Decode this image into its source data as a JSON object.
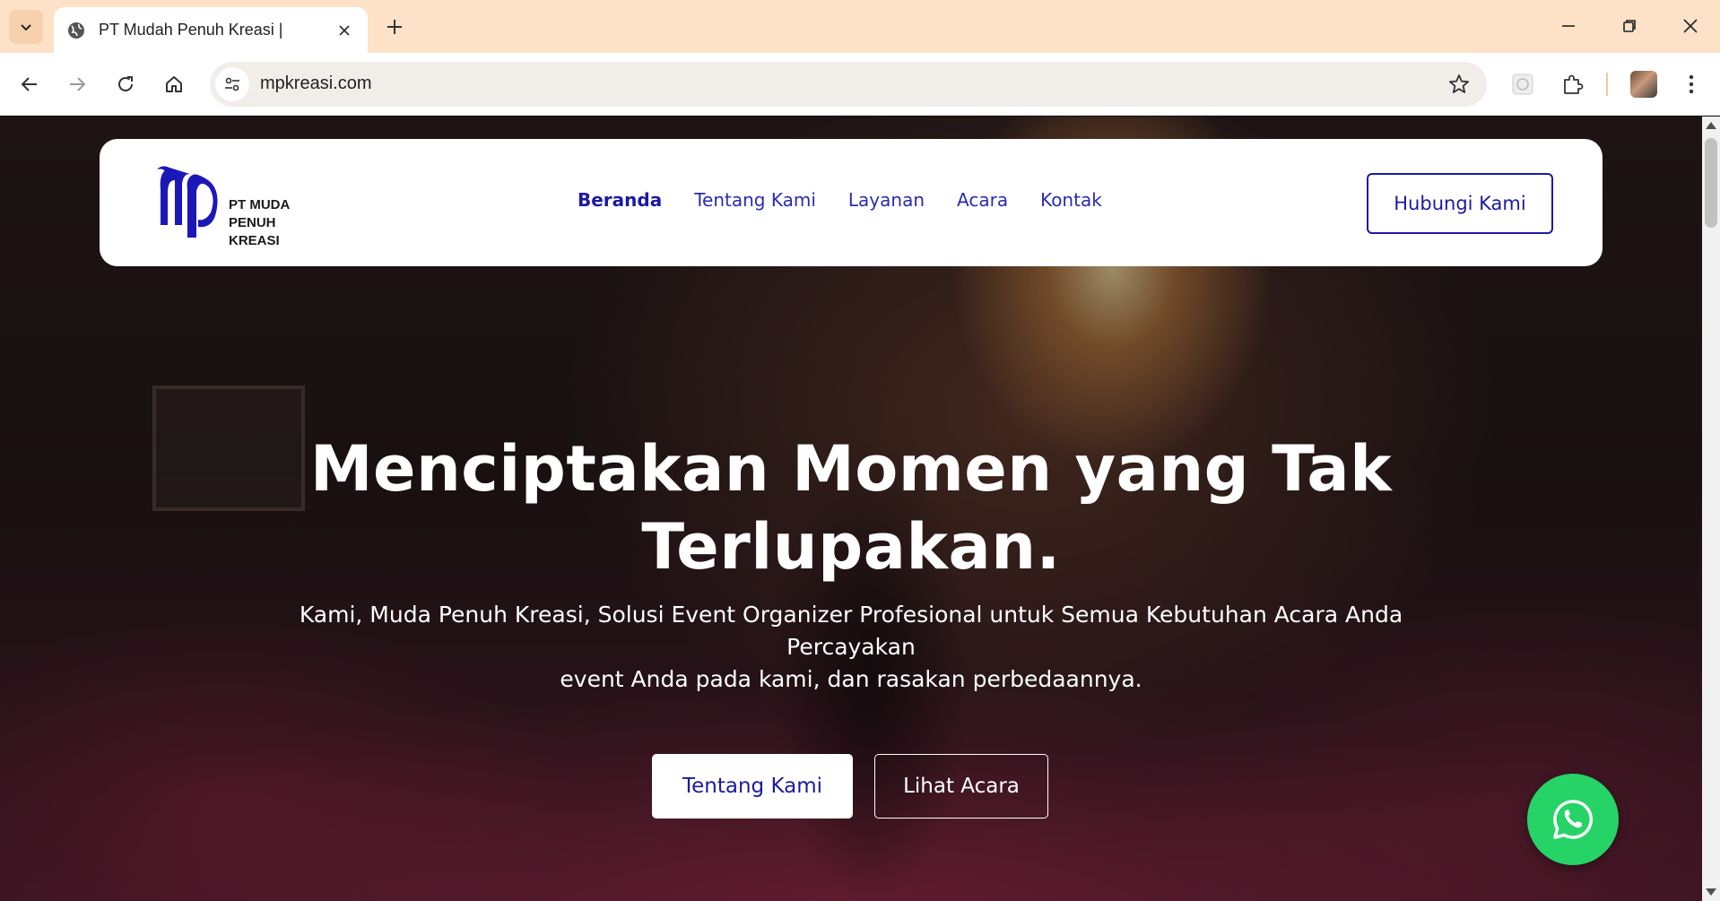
{
  "browser": {
    "tab_title": "PT Mudah Penuh Kreasi |",
    "url": "mpkreasi.com",
    "icons": {
      "tab_list": "chevron-down-icon",
      "tab_favicon": "globe-icon",
      "tab_close": "close-icon",
      "new_tab": "plus-icon",
      "minimize": "minimize-icon",
      "restore": "restore-icon",
      "close_window": "close-icon",
      "back": "back-arrow-icon",
      "forward": "forward-arrow-icon",
      "reload": "reload-icon",
      "home": "home-icon",
      "site_info": "tune-icon",
      "bookmark": "star-icon",
      "extension_1": "extension-icon",
      "extensions": "puzzle-icon",
      "profile": "avatar",
      "menu": "kebab-menu-icon"
    }
  },
  "navbar": {
    "logo_lines": [
      "PT MUDA",
      "PENUH",
      "KREASI"
    ],
    "links": [
      {
        "label": "Beranda",
        "active": true
      },
      {
        "label": "Tentang Kami",
        "active": false
      },
      {
        "label": "Layanan",
        "active": false
      },
      {
        "label": "Acara",
        "active": false
      },
      {
        "label": "Kontak",
        "active": false
      }
    ],
    "cta_label": "Hubungi Kami"
  },
  "hero": {
    "title_line1": "Menciptakan Momen yang Tak",
    "title_line2": "Terlupakan.",
    "subtitle_line1": "Kami, Muda Penuh Kreasi, Solusi Event Organizer Profesional untuk Semua Kebutuhan Acara Anda Percayakan",
    "subtitle_line2": "event Anda pada kami, dan rasakan perbedaannya.",
    "primary_button": "Tentang Kami",
    "secondary_button": "Lihat Acara"
  },
  "floating": {
    "whatsapp_icon": "whatsapp-icon"
  },
  "colors": {
    "brand_blue": "#1c1aa0",
    "whatsapp_green": "#25d366",
    "tabbar_bg": "#fde2c8"
  }
}
